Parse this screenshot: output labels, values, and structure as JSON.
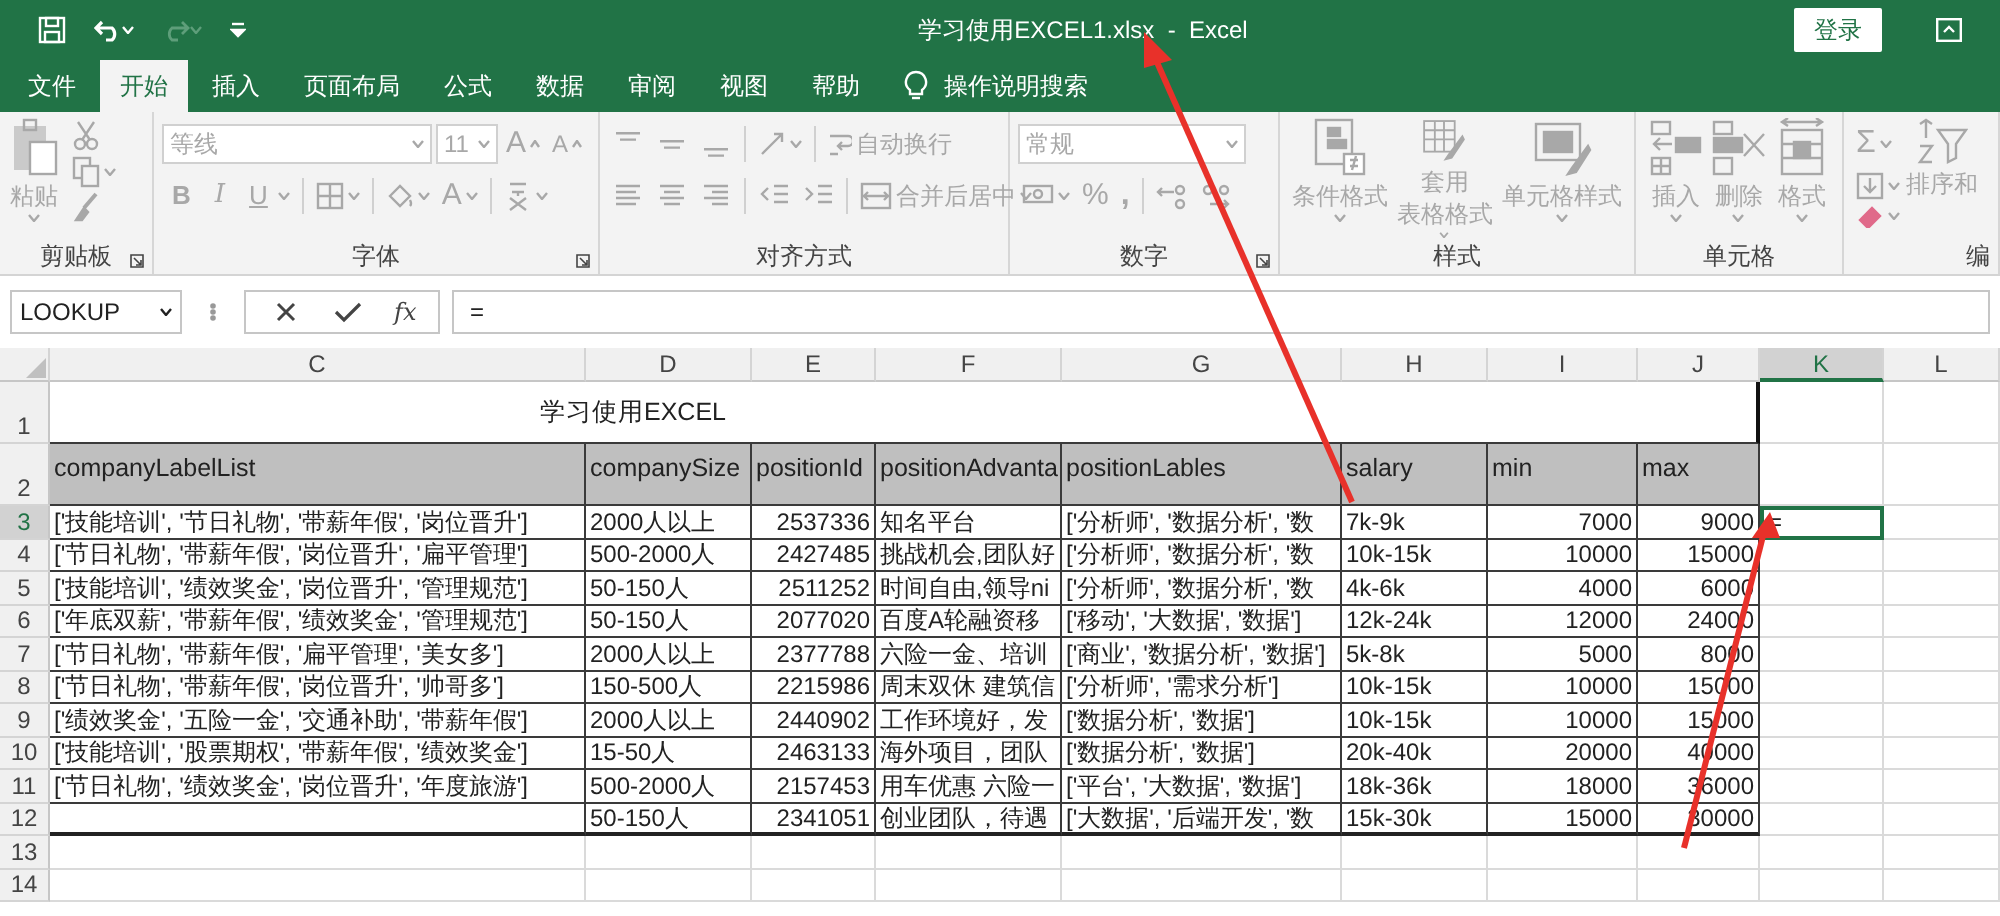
{
  "title_bar": {
    "title": "学习使用EXCEL1.xlsx  -  Excel",
    "sign_in": "登录"
  },
  "tabs": [
    {
      "label": "文件",
      "selected": false
    },
    {
      "label": "开始",
      "selected": true
    },
    {
      "label": "插入",
      "selected": false
    },
    {
      "label": "页面布局",
      "selected": false
    },
    {
      "label": "公式",
      "selected": false
    },
    {
      "label": "数据",
      "selected": false
    },
    {
      "label": "审阅",
      "selected": false
    },
    {
      "label": "视图",
      "selected": false
    },
    {
      "label": "帮助",
      "selected": false
    }
  ],
  "tell_me": "操作说明搜索",
  "ribbon": {
    "disabled": true,
    "groups": [
      {
        "kind": "clipboard",
        "label": "剪贴板",
        "launcher": true,
        "paste": "粘贴"
      },
      {
        "kind": "font",
        "label": "字体",
        "launcher": true,
        "font": "等线",
        "size": "11",
        "size_buttons": [
          "A",
          "A"
        ],
        "style_buttons": [
          "B",
          "I",
          "U"
        ],
        "font_color": "A"
      },
      {
        "kind": "alignment",
        "label": "对齐方式",
        "launcher": false,
        "wrap": "自动换行",
        "merge": "合并后居中"
      },
      {
        "kind": "number",
        "label": "数字",
        "launcher": true,
        "format": "常规",
        "percent": "%",
        "comma": ","
      },
      {
        "kind": "styles",
        "label": "样式",
        "launcher": false,
        "buttons": [
          {
            "lines": [
              "条件格式"
            ]
          },
          {
            "lines": [
              "套用",
              "表格格式"
            ]
          },
          {
            "lines": [
              "单元格样式"
            ]
          }
        ]
      },
      {
        "kind": "cells",
        "label": "单元格",
        "launcher": false,
        "buttons": [
          {
            "lines": [
              "插入"
            ]
          },
          {
            "lines": [
              "删除"
            ]
          },
          {
            "lines": [
              "格式"
            ]
          }
        ]
      },
      {
        "kind": "editing",
        "label": "编",
        "launcher": false,
        "sum": "Σ",
        "sort": "排序和"
      }
    ]
  },
  "formula_bar": {
    "name_box": "LOOKUP",
    "function_button": "fx",
    "formula": "="
  },
  "columns": [
    {
      "label": "C",
      "kind": "text",
      "selected": false
    },
    {
      "label": "D",
      "kind": "text",
      "selected": false
    },
    {
      "label": "E",
      "kind": "number",
      "selected": false
    },
    {
      "label": "F",
      "kind": "text",
      "selected": false
    },
    {
      "label": "G",
      "kind": "text",
      "selected": false
    },
    {
      "label": "H",
      "kind": "text",
      "selected": false
    },
    {
      "label": "I",
      "kind": "number",
      "selected": false
    },
    {
      "label": "J",
      "kind": "number",
      "selected": false
    },
    {
      "label": "K",
      "kind": "text",
      "selected": true
    },
    {
      "label": "L",
      "kind": "text",
      "selected": false
    }
  ],
  "rows": [
    {
      "kind": "title",
      "number": "1",
      "selected": false,
      "text": "学习使用EXCEL"
    },
    {
      "kind": "header",
      "number": "2",
      "selected": false,
      "cells": [
        "companyLabelList",
        "companySize",
        "positionId",
        "positionAdvanta",
        "positionLables",
        "salary",
        "min",
        "max",
        null,
        null
      ]
    },
    {
      "kind": "data",
      "number": "3",
      "selected": true,
      "cells": [
        "['技能培训', '节日礼物', '带薪年假', '岗位晋升']",
        "2000人以上",
        "2537336",
        "知名平台",
        "['分析师', '数据分析', '数",
        "7k-9k",
        "7000",
        "9000",
        "=",
        null
      ]
    },
    {
      "kind": "data",
      "number": "4",
      "selected": false,
      "cells": [
        "['节日礼物', '带薪年假', '岗位晋升', '扁平管理']",
        "500-2000人",
        "2427485",
        "挑战机会,团队好",
        "['分析师', '数据分析', '数",
        "10k-15k",
        "10000",
        "15000",
        null,
        null
      ]
    },
    {
      "kind": "data",
      "number": "5",
      "selected": false,
      "cells": [
        "['技能培训', '绩效奖金', '岗位晋升', '管理规范']",
        "50-150人",
        "2511252",
        "时间自由,领导ni",
        "['分析师', '数据分析', '数",
        "4k-6k",
        "4000",
        "6000",
        null,
        null
      ]
    },
    {
      "kind": "data",
      "number": "6",
      "selected": false,
      "cells": [
        "['年底双薪', '带薪年假', '绩效奖金', '管理规范']",
        "50-150人",
        "2077020",
        "百度A轮融资移",
        "['移动', '大数据', '数据']",
        "12k-24k",
        "12000",
        "24000",
        null,
        null
      ]
    },
    {
      "kind": "data",
      "number": "7",
      "selected": false,
      "cells": [
        "['节日礼物', '带薪年假', '扁平管理', '美女多']",
        "2000人以上",
        "2377788",
        "六险一金、培训",
        "['商业', '数据分析', '数据']",
        "5k-8k",
        "5000",
        "8000",
        null,
        null
      ]
    },
    {
      "kind": "data",
      "number": "8",
      "selected": false,
      "cells": [
        "['节日礼物', '带薪年假', '岗位晋升', '帅哥多']",
        "150-500人",
        "2215986",
        "周末双休 建筑信",
        "['分析师', '需求分析']",
        "10k-15k",
        "10000",
        "15000",
        null,
        null
      ]
    },
    {
      "kind": "data",
      "number": "9",
      "selected": false,
      "cells": [
        "['绩效奖金', '五险一金', '交通补助', '带薪年假']",
        "2000人以上",
        "2440902",
        "工作环境好，发",
        "['数据分析', '数据']",
        "10k-15k",
        "10000",
        "15000",
        null,
        null
      ]
    },
    {
      "kind": "data",
      "number": "10",
      "selected": false,
      "cells": [
        "['技能培训', '股票期权', '带薪年假', '绩效奖金']",
        "15-50人",
        "2463133",
        "海外项目，团队",
        "['数据分析', '数据']",
        "20k-40k",
        "20000",
        "40000",
        null,
        null
      ]
    },
    {
      "kind": "data",
      "number": "11",
      "selected": false,
      "cells": [
        "['节日礼物', '绩效奖金', '岗位晋升', '年度旅游']",
        "500-2000人",
        "2157453",
        "用车优惠 六险一",
        "['平台', '大数据', '数据']",
        "18k-36k",
        "18000",
        "36000",
        null,
        null
      ]
    },
    {
      "kind": "data",
      "number": "12",
      "selected": false,
      "cells": [
        null,
        "50-150人",
        "2341051",
        "创业团队，待遇",
        "['大数据', '后端开发', '数",
        "15k-30k",
        "15000",
        "30000",
        null,
        null
      ]
    },
    {
      "kind": "empty",
      "number": "13",
      "selected": false
    },
    {
      "kind": "empty",
      "number": "14",
      "selected": false
    }
  ]
}
